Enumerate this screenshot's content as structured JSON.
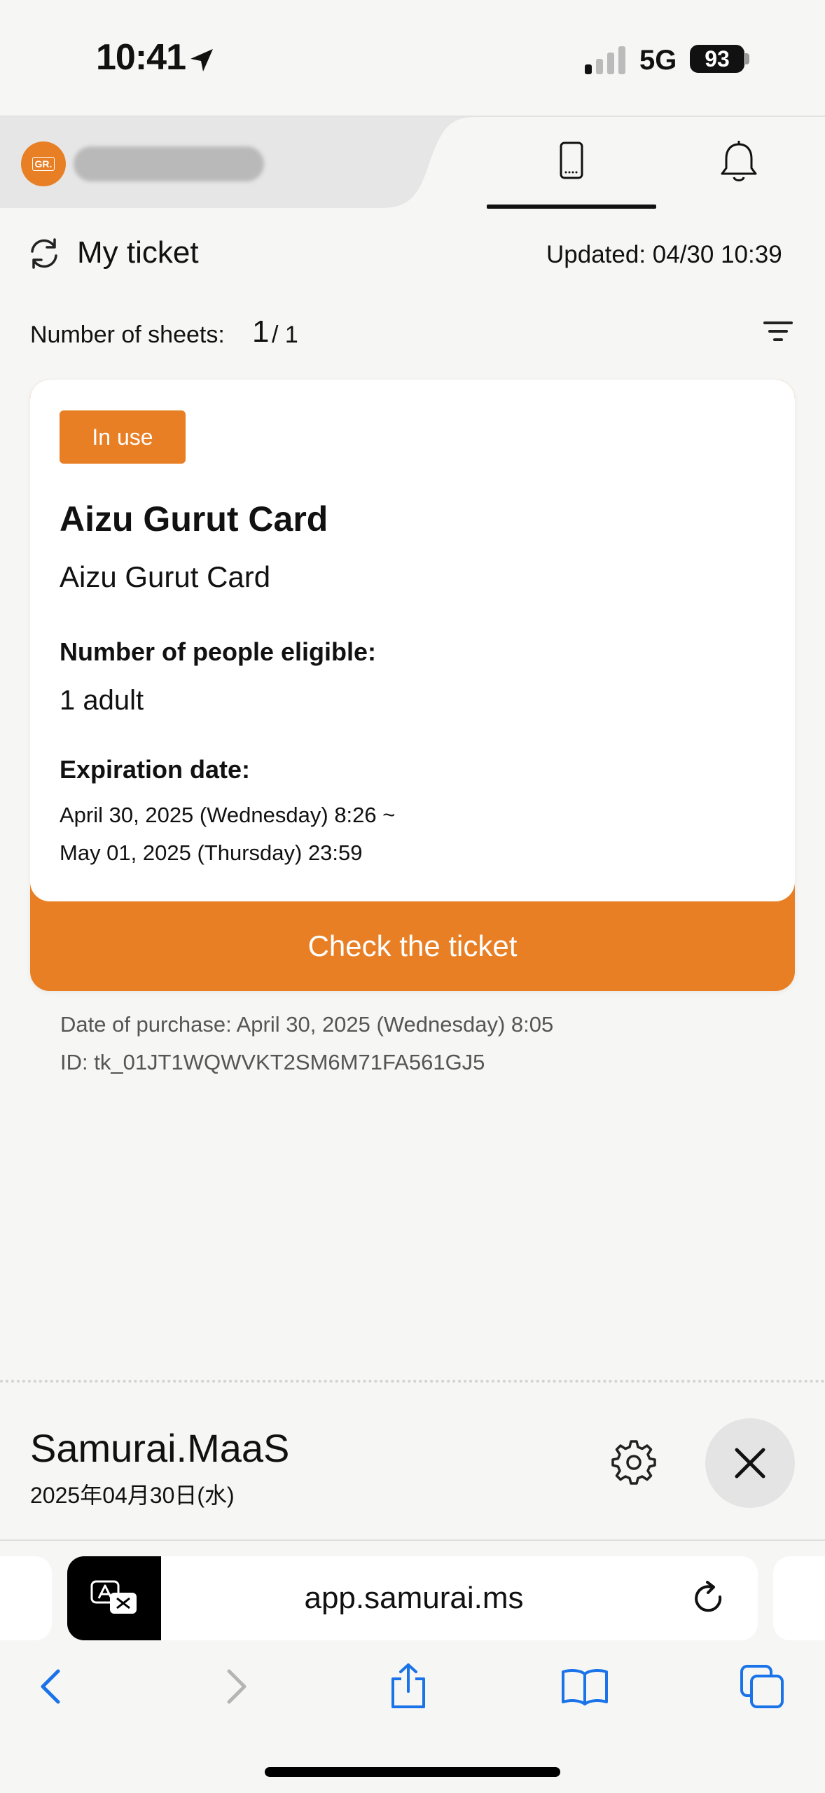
{
  "status_bar": {
    "time": "10:41",
    "network": "5G",
    "battery": "93"
  },
  "header": {
    "logo_text": "GR.",
    "tabs": [
      {
        "icon": "phone-ticket-icon",
        "active": true
      },
      {
        "icon": "bell-icon",
        "active": false
      }
    ]
  },
  "ticket_section": {
    "title": "My ticket",
    "updated": "Updated: 04/30 10:39",
    "sheets_label": "Number of sheets:",
    "sheets_current": "1",
    "sheets_total": "/ 1"
  },
  "ticket": {
    "status": "In use",
    "name": "Aizu Gurut Card",
    "subname": "Aizu Gurut Card",
    "eligible_label": "Number of people eligible:",
    "eligible_value": "1 adult",
    "expiry_label": "Expiration date:",
    "expiry_from": "April 30, 2025 (Wednesday) 8:26 ~",
    "expiry_to": "May 01, 2025 (Thursday) 23:59",
    "check_button": "Check the ticket",
    "purchase_date": "Date of purchase: April 30, 2025 (Wednesday) 8:05",
    "id": "ID: tk_01JT1WQWVKT2SM6M71FA561GJ5"
  },
  "app_bar": {
    "title": "Samurai.MaaS",
    "date": "2025年04月30日(水)"
  },
  "browser": {
    "url": "app.samurai.ms"
  },
  "colors": {
    "accent": "#e87f24",
    "background": "#f6f6f5",
    "safari_blue": "#1a73e8"
  }
}
